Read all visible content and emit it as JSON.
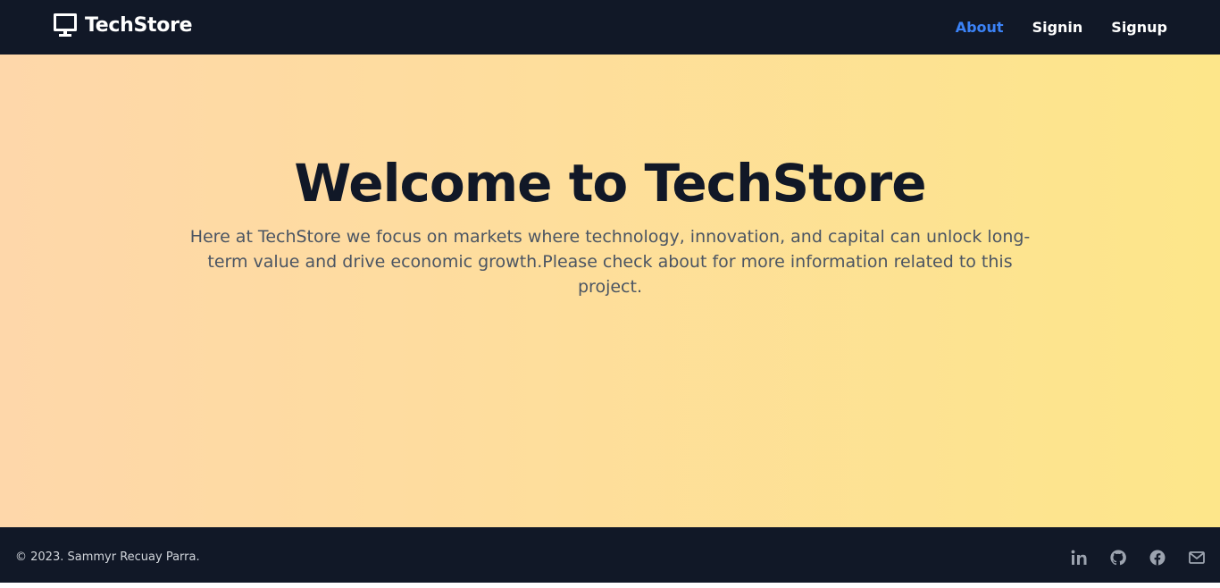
{
  "header": {
    "brand": "TechStore",
    "brand_icon": "monitor-icon",
    "nav": [
      {
        "label": "About",
        "active": true
      },
      {
        "label": "Signin",
        "active": false
      },
      {
        "label": "Signup",
        "active": false
      }
    ]
  },
  "hero": {
    "title": "Welcome to TechStore",
    "description": "Here at TechStore we focus on markets where technology, innovation, and capital can unlock long-term value and drive economic growth.Please check about for more information related to this project."
  },
  "footer": {
    "copyright": "© 2023. Sammyr Recuay Parra.",
    "social_icons": [
      "linkedin-icon",
      "github-icon",
      "facebook-icon",
      "mail-icon"
    ]
  },
  "colors": {
    "navbar_bg": "#111827",
    "accent": "#3b82f6",
    "gradient_start": "#fed7aa",
    "gradient_end": "#fde68a",
    "title": "#111827",
    "body_text": "#4b5563"
  }
}
